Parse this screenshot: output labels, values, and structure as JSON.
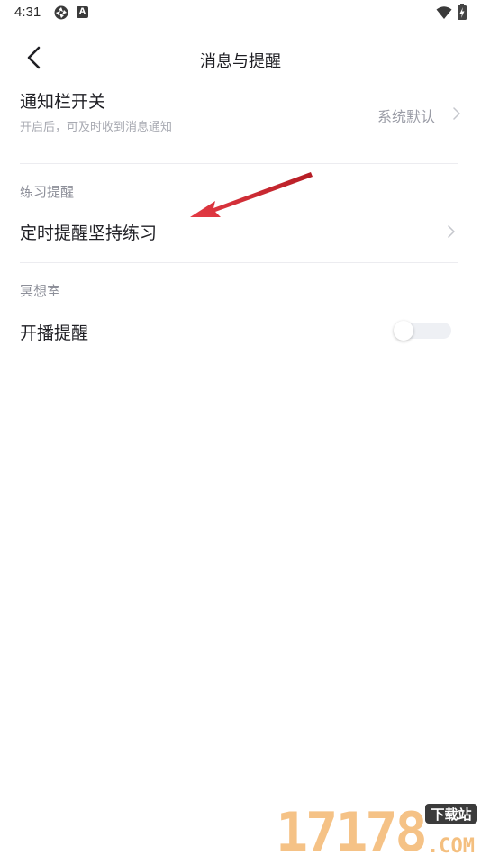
{
  "status_bar": {
    "time": "4:31",
    "badge_letter": "A",
    "battery_color": "#444444"
  },
  "nav": {
    "title": "消息与提醒"
  },
  "notification_bar": {
    "title": "通知栏开关",
    "subtitle": "开启后，可及时收到消息通知",
    "value": "系统默认"
  },
  "practice_section": {
    "header": "练习提醒",
    "item_title": "定时提醒坚持练习"
  },
  "meditation_section": {
    "header": "冥想室",
    "item_title": "开播提醒",
    "toggle_on": false
  },
  "watermark": {
    "number": "17178",
    "tag": "下载站",
    "domain": ".COM",
    "color": "#f0a040"
  },
  "colors": {
    "text_primary": "#1f1f24",
    "text_secondary": "#a8aab2",
    "arrow": "#d0202a"
  }
}
